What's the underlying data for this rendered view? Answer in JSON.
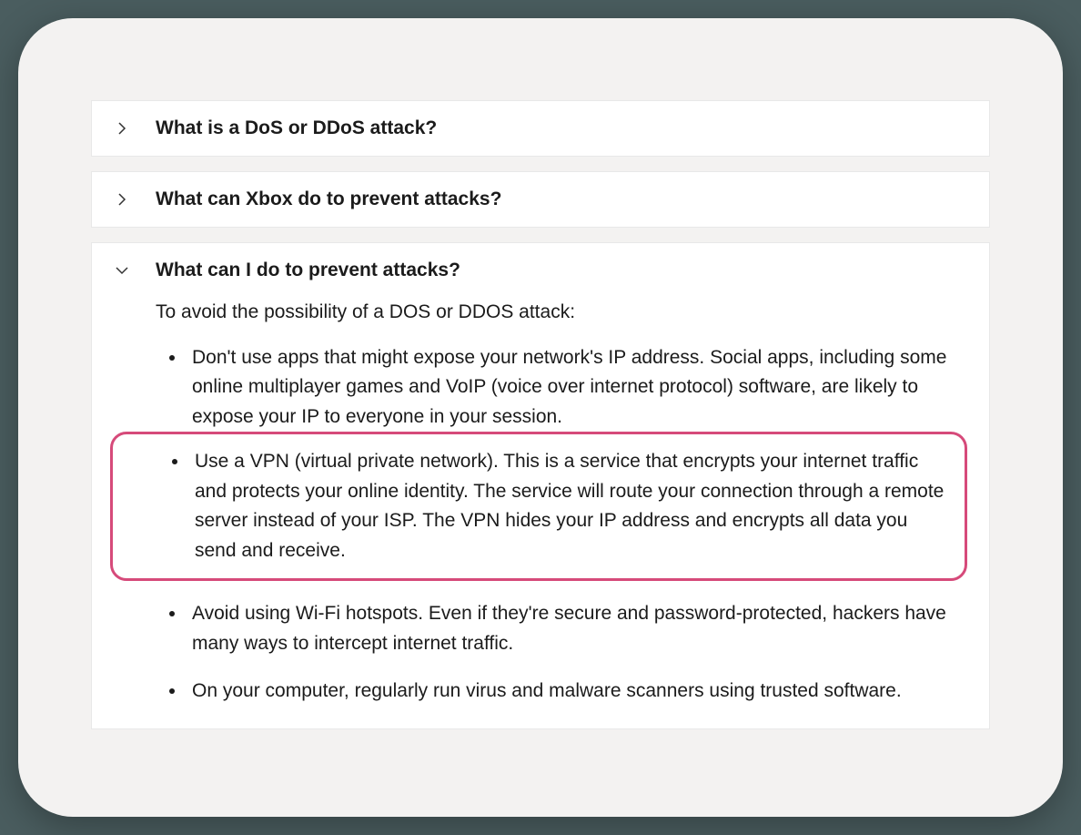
{
  "faq": [
    {
      "title": "What is a DoS or DDoS attack?",
      "expanded": false
    },
    {
      "title": "What can Xbox do to prevent attacks?",
      "expanded": false
    },
    {
      "title": "What can I do to prevent attacks?",
      "expanded": true,
      "intro": "To avoid the possibility of a DOS or DDOS attack:",
      "bullets": [
        "Don't use apps that might expose your network's IP address. Social apps, including some online multiplayer games and VoIP (voice over internet protocol) software, are likely to expose your IP to everyone in your session.",
        "Use a VPN (virtual private network). This is a service that encrypts your internet traffic and protects your online identity. The service will route your connection through a remote server instead of your ISP. The VPN hides your IP address and encrypts all data you send and receive.",
        "Avoid using Wi-Fi hotspots. Even if they're secure and password-protected, hackers have many ways to intercept internet traffic.",
        "On your computer, regularly run virus and malware scanners using trusted software."
      ]
    }
  ]
}
